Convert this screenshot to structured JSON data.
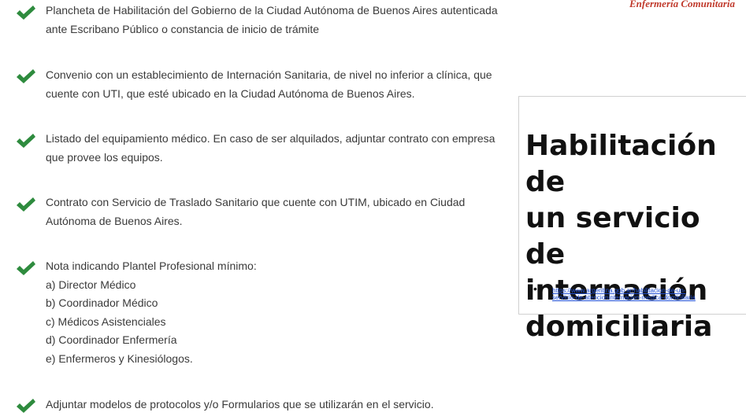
{
  "brand": "Enfermería Comunitaria",
  "requirements": [
    {
      "lines": [
        "Plancheta de Habilitación del Gobierno de la Ciudad Autónoma de Buenos Aires autenticada",
        "ante Escribano Público o constancia de inicio de trámite"
      ]
    },
    {
      "lines": [
        "Convenio con un establecimiento de Internación Sanitaria, de nivel no inferior a clínica, que",
        "cuente con UTI, que esté ubicado en la Ciudad Autónoma de Buenos Aires."
      ]
    },
    {
      "lines": [
        "Listado del equipamiento médico. En caso de ser alquilados, adjuntar contrato con empresa",
        "que provee los equipos."
      ]
    },
    {
      "lines": [
        "Contrato con Servicio de Traslado Sanitario que cuente con UTIM, ubicado en Ciudad",
        "Autónoma de Buenos Aires."
      ]
    },
    {
      "lines": [
        "Nota indicando Plantel Profesional mínimo:"
      ],
      "sub_items": [
        "a) Director Médico",
        "b) Coordinador Médico",
        "c) Médicos Asistenciales",
        "d) Coordinador Enfermería",
        "e) Enfermeros y Kinesiólogos."
      ]
    },
    {
      "lines": [
        "Adjuntar modelos de protocolos y/o Formularios que se utilizarán en el servicio."
      ]
    }
  ],
  "panel": {
    "title_lines": [
      "Habilitación de",
      "un servicio de",
      "internación",
      "domiciliaria"
    ],
    "bullet": "•",
    "link_lines": [
      "https://www.argentina.gob.ar/habilitacion-de-un-",
      "servicio-de-atencioninternacion-medica-domiciliaria"
    ]
  },
  "colors": {
    "check": "#2e8b3e",
    "brand": "#c0392b",
    "link": "#1f4fd6"
  },
  "icons": {
    "check": "check-icon"
  }
}
